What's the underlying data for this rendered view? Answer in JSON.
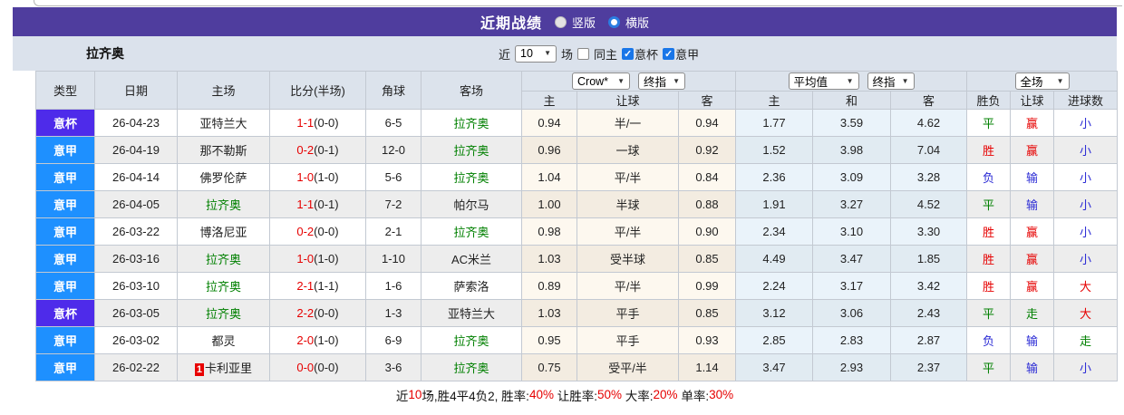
{
  "colors": {
    "accent_purple": "#4f3d9e",
    "cup_bg": "#4e2bea",
    "league_bg": "#1e90ff",
    "win_red": "#e60000",
    "draw_green": "#008000",
    "lose_blue": "#2b2bd5",
    "team_green": "#008000"
  },
  "title_bar": {
    "title": "近期战绩",
    "radio_vertical": "竖版",
    "radio_horizontal": "横版",
    "selected": "横版"
  },
  "toolbar": {
    "team": "拉齐奥",
    "near_label": "近",
    "match_count": "10",
    "unit_label": "场",
    "same_home_label": "同主",
    "cup_label": "意杯",
    "league_label": "意甲",
    "same_home_checked": false,
    "cup_checked": true,
    "league_checked": true
  },
  "table": {
    "headers": {
      "type": "类型",
      "date": "日期",
      "home": "主场",
      "score": "比分(半场)",
      "corner": "角球",
      "away": "客场",
      "odds_home": "主",
      "odds_handicap": "让球",
      "odds_away": "客",
      "avg_home": "主",
      "avg_draw": "和",
      "avg_away": "客",
      "result_wdl": "胜负",
      "result_handicap": "让球",
      "result_goals": "进球数"
    },
    "selects": {
      "bookmaker": "Crow*",
      "final_index_1": "终指",
      "average": "平均值",
      "final_index_2": "终指",
      "full_match": "全场"
    },
    "rows": [
      {
        "type": "意杯",
        "type_class": "cup",
        "date": "26-04-23",
        "home": {
          "text": "亚特兰大",
          "color": "dark",
          "badge": ""
        },
        "score_full": "1-1",
        "score_half": "(0-0)",
        "corner": "6-5",
        "away": {
          "text": "拉齐奥",
          "color": "green",
          "badge": ""
        },
        "odds_home": "0.94",
        "handicap": "半/一",
        "odds_away": "0.94",
        "avg_home": "1.77",
        "avg_draw": "3.59",
        "avg_away": "4.62",
        "wdl": {
          "text": "平",
          "color": "green"
        },
        "hcp": {
          "text": "赢",
          "color": "red"
        },
        "goals": {
          "text": "小",
          "color": "blue"
        }
      },
      {
        "type": "意甲",
        "type_class": "league",
        "date": "26-04-19",
        "home": {
          "text": "那不勒斯",
          "color": "dark",
          "badge": ""
        },
        "score_full": "0-2",
        "score_half": "(0-1)",
        "corner": "12-0",
        "away": {
          "text": "拉齐奥",
          "color": "green",
          "badge": ""
        },
        "odds_home": "0.96",
        "handicap": "一球",
        "odds_away": "0.92",
        "avg_home": "1.52",
        "avg_draw": "3.98",
        "avg_away": "7.04",
        "wdl": {
          "text": "胜",
          "color": "red"
        },
        "hcp": {
          "text": "赢",
          "color": "red"
        },
        "goals": {
          "text": "小",
          "color": "blue"
        }
      },
      {
        "type": "意甲",
        "type_class": "league",
        "date": "26-04-14",
        "home": {
          "text": "佛罗伦萨",
          "color": "dark",
          "badge": ""
        },
        "score_full": "1-0",
        "score_half": "(1-0)",
        "corner": "5-6",
        "away": {
          "text": "拉齐奥",
          "color": "green",
          "badge": ""
        },
        "odds_home": "1.04",
        "handicap": "平/半",
        "odds_away": "0.84",
        "avg_home": "2.36",
        "avg_draw": "3.09",
        "avg_away": "3.28",
        "wdl": {
          "text": "负",
          "color": "blue"
        },
        "hcp": {
          "text": "输",
          "color": "blue"
        },
        "goals": {
          "text": "小",
          "color": "blue"
        }
      },
      {
        "type": "意甲",
        "type_class": "league",
        "date": "26-04-05",
        "home": {
          "text": "拉齐奥",
          "color": "green",
          "badge": ""
        },
        "score_full": "1-1",
        "score_half": "(0-1)",
        "corner": "7-2",
        "away": {
          "text": "帕尔马",
          "color": "dark",
          "badge": ""
        },
        "odds_home": "1.00",
        "handicap": "半球",
        "odds_away": "0.88",
        "avg_home": "1.91",
        "avg_draw": "3.27",
        "avg_away": "4.52",
        "wdl": {
          "text": "平",
          "color": "green"
        },
        "hcp": {
          "text": "输",
          "color": "blue"
        },
        "goals": {
          "text": "小",
          "color": "blue"
        }
      },
      {
        "type": "意甲",
        "type_class": "league",
        "date": "26-03-22",
        "home": {
          "text": "博洛尼亚",
          "color": "dark",
          "badge": ""
        },
        "score_full": "0-2",
        "score_half": "(0-0)",
        "corner": "2-1",
        "away": {
          "text": "拉齐奥",
          "color": "green",
          "badge": ""
        },
        "odds_home": "0.98",
        "handicap": "平/半",
        "odds_away": "0.90",
        "avg_home": "2.34",
        "avg_draw": "3.10",
        "avg_away": "3.30",
        "wdl": {
          "text": "胜",
          "color": "red"
        },
        "hcp": {
          "text": "赢",
          "color": "red"
        },
        "goals": {
          "text": "小",
          "color": "blue"
        }
      },
      {
        "type": "意甲",
        "type_class": "league",
        "date": "26-03-16",
        "home": {
          "text": "拉齐奥",
          "color": "green",
          "badge": ""
        },
        "score_full": "1-0",
        "score_half": "(1-0)",
        "corner": "1-10",
        "away": {
          "text": "AC米兰",
          "color": "dark",
          "badge": ""
        },
        "odds_home": "1.03",
        "handicap": "受半球",
        "odds_away": "0.85",
        "avg_home": "4.49",
        "avg_draw": "3.47",
        "avg_away": "1.85",
        "wdl": {
          "text": "胜",
          "color": "red"
        },
        "hcp": {
          "text": "赢",
          "color": "red"
        },
        "goals": {
          "text": "小",
          "color": "blue"
        }
      },
      {
        "type": "意甲",
        "type_class": "league",
        "date": "26-03-10",
        "home": {
          "text": "拉齐奥",
          "color": "green",
          "badge": ""
        },
        "score_full": "2-1",
        "score_half": "(1-1)",
        "corner": "1-6",
        "away": {
          "text": "萨索洛",
          "color": "dark",
          "badge": ""
        },
        "odds_home": "0.89",
        "handicap": "平/半",
        "odds_away": "0.99",
        "avg_home": "2.24",
        "avg_draw": "3.17",
        "avg_away": "3.42",
        "wdl": {
          "text": "胜",
          "color": "red"
        },
        "hcp": {
          "text": "赢",
          "color": "red"
        },
        "goals": {
          "text": "大",
          "color": "red"
        }
      },
      {
        "type": "意杯",
        "type_class": "cup",
        "date": "26-03-05",
        "home": {
          "text": "拉齐奥",
          "color": "green",
          "badge": ""
        },
        "score_full": "2-2",
        "score_half": "(0-0)",
        "corner": "1-3",
        "away": {
          "text": "亚特兰大",
          "color": "dark",
          "badge": ""
        },
        "odds_home": "1.03",
        "handicap": "平手",
        "odds_away": "0.85",
        "avg_home": "3.12",
        "avg_draw": "3.06",
        "avg_away": "2.43",
        "wdl": {
          "text": "平",
          "color": "green"
        },
        "hcp": {
          "text": "走",
          "color": "green"
        },
        "goals": {
          "text": "大",
          "color": "red"
        }
      },
      {
        "type": "意甲",
        "type_class": "league",
        "date": "26-03-02",
        "home": {
          "text": "都灵",
          "color": "dark",
          "badge": ""
        },
        "score_full": "2-0",
        "score_half": "(1-0)",
        "corner": "6-9",
        "away": {
          "text": "拉齐奥",
          "color": "green",
          "badge": ""
        },
        "odds_home": "0.95",
        "handicap": "平手",
        "odds_away": "0.93",
        "avg_home": "2.85",
        "avg_draw": "2.83",
        "avg_away": "2.87",
        "wdl": {
          "text": "负",
          "color": "blue"
        },
        "hcp": {
          "text": "输",
          "color": "blue"
        },
        "goals": {
          "text": "走",
          "color": "green"
        }
      },
      {
        "type": "意甲",
        "type_class": "league",
        "date": "26-02-22",
        "home": {
          "text": "卡利亚里",
          "color": "dark",
          "badge": "1"
        },
        "score_full": "0-0",
        "score_half": "(0-0)",
        "corner": "3-6",
        "away": {
          "text": "拉齐奥",
          "color": "green",
          "badge": ""
        },
        "odds_home": "0.75",
        "handicap": "受平/半",
        "odds_away": "1.14",
        "avg_home": "3.47",
        "avg_draw": "2.93",
        "avg_away": "2.37",
        "wdl": {
          "text": "平",
          "color": "green"
        },
        "hcp": {
          "text": "输",
          "color": "blue"
        },
        "goals": {
          "text": "小",
          "color": "blue"
        }
      }
    ]
  },
  "footer": {
    "segments": [
      {
        "text": "近",
        "red": false
      },
      {
        "text": "10",
        "red": true
      },
      {
        "text": "场,胜4平4负2, 胜率:",
        "red": false
      },
      {
        "text": "40%",
        "red": true
      },
      {
        "text": " 让胜率:",
        "red": false
      },
      {
        "text": "50%",
        "red": true
      },
      {
        "text": " 大率:",
        "red": false
      },
      {
        "text": "20%",
        "red": true
      },
      {
        "text": " 单率:",
        "red": false
      },
      {
        "text": "30%",
        "red": true
      }
    ]
  }
}
